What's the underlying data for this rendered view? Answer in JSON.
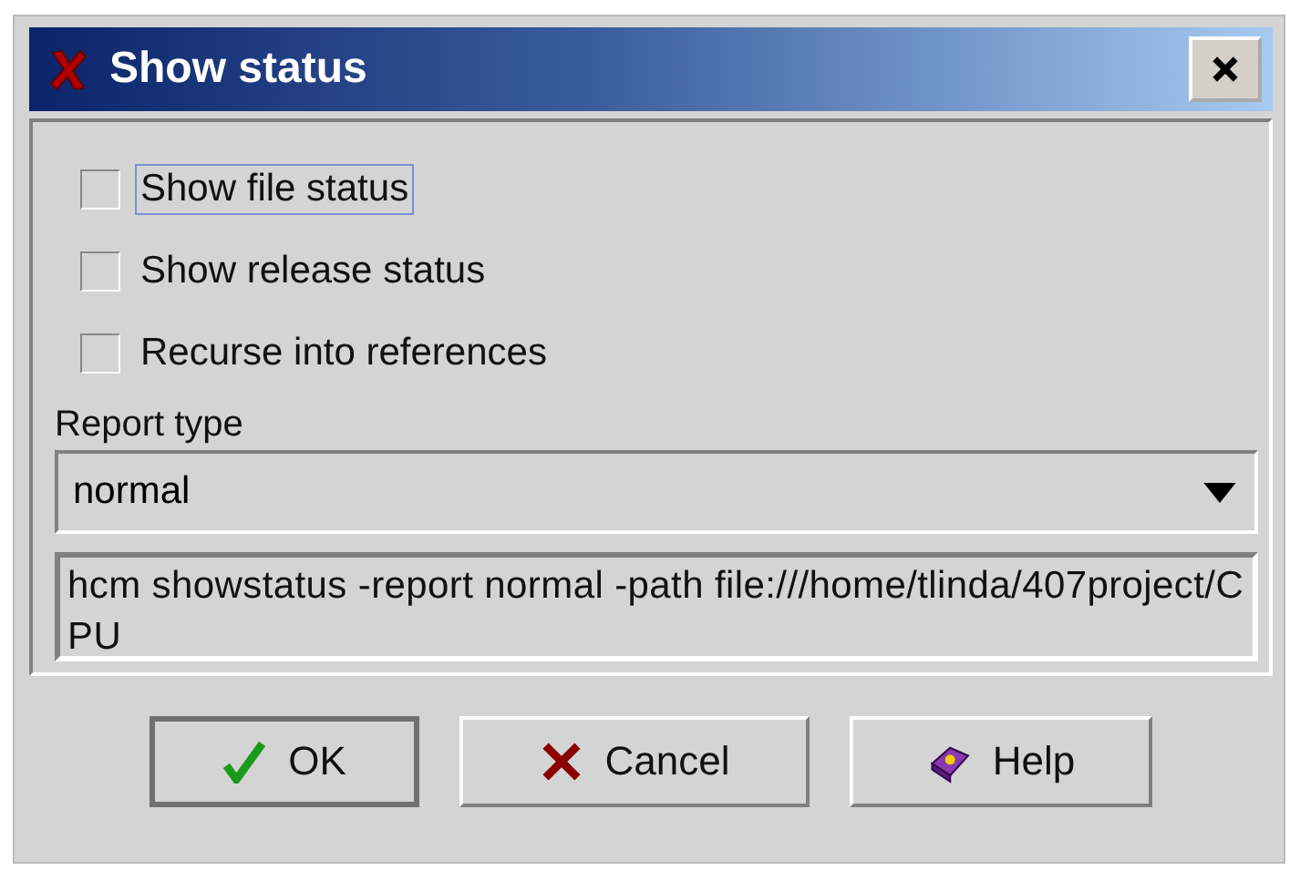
{
  "window": {
    "title": "Show status"
  },
  "checkboxes": [
    {
      "label": "Show file status",
      "checked": false,
      "focused": true
    },
    {
      "label": "Show release status",
      "checked": false,
      "focused": false
    },
    {
      "label": "Recurse into references",
      "checked": false,
      "focused": false
    }
  ],
  "report_type": {
    "label": "Report type",
    "value": "normal"
  },
  "command": {
    "value": "hcm showstatus -report normal -path file:///home/tlinda/407project/CPU"
  },
  "buttons": [
    {
      "label": "OK",
      "kind": "ok",
      "default": true
    },
    {
      "label": "Cancel",
      "kind": "cancel",
      "default": false
    },
    {
      "label": "Help",
      "kind": "help",
      "default": false
    }
  ]
}
